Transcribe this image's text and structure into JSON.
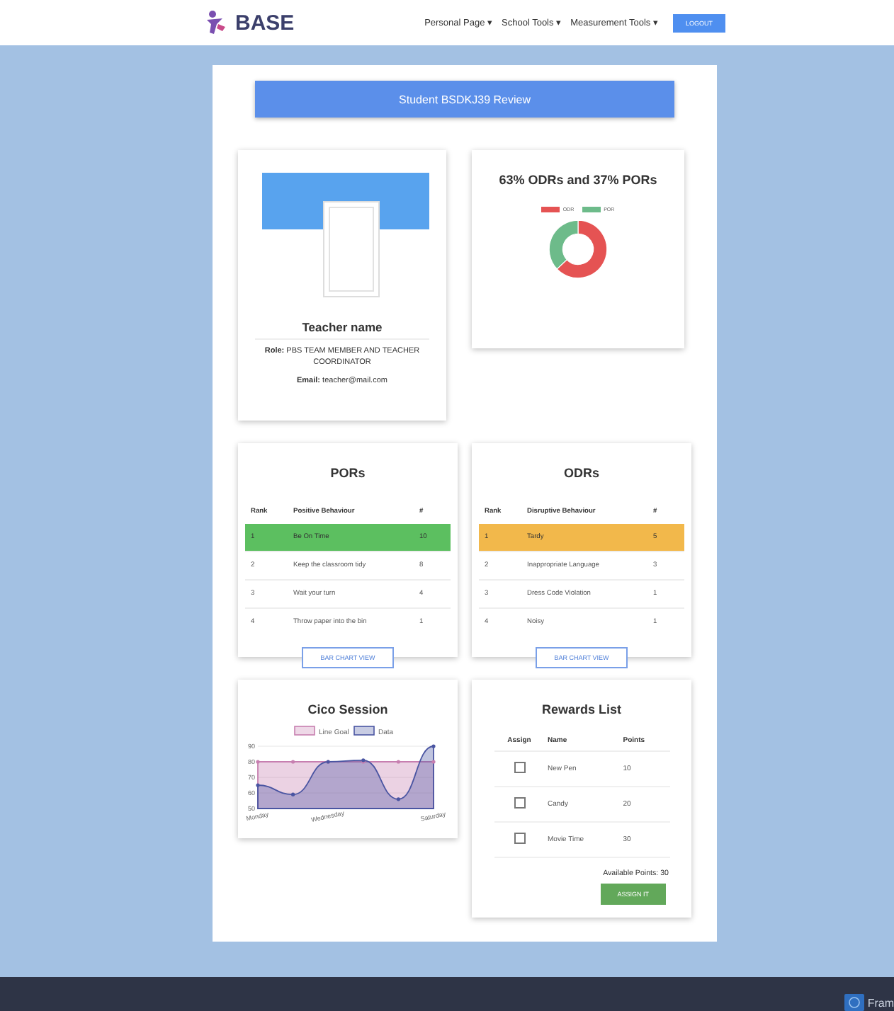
{
  "nav": {
    "logo": "BASE",
    "menus": [
      {
        "label": "Personal Page",
        "caret": "▾"
      },
      {
        "label": "School Tools",
        "caret": "▾"
      },
      {
        "label": "Measurement Tools",
        "caret": "▾"
      }
    ],
    "logout": "LOGOUT"
  },
  "header": {
    "title": "Student BSDKJ39 Review"
  },
  "teacher": {
    "name": "Teacher name",
    "role_label": "Role:",
    "role": "PBS TEAM MEMBER AND TEACHER COORDINATOR",
    "email_label": "Email:",
    "email": "teacher@mail.com"
  },
  "ratio": {
    "title": "63% ODRs and 37% PORs",
    "chart_data": {
      "type": "donut",
      "categories": [
        "ODR",
        "POR"
      ],
      "values": [
        63,
        37
      ],
      "colors": [
        "#e55353",
        "#6dbb8a"
      ],
      "legend": "top"
    }
  },
  "tables": [
    {
      "title": "PORs",
      "kind": "positive",
      "columns": [
        "Rank",
        "Positive Behaviour",
        "#"
      ],
      "rows": [
        {
          "cells": [
            "1",
            "Be On Time",
            "10"
          ],
          "highlighted": true
        },
        {
          "cells": [
            "2",
            "Keep the classroom tidy",
            "8"
          ],
          "highlighted": false
        },
        {
          "cells": [
            "3",
            "Wait your turn",
            "4"
          ],
          "highlighted": false
        },
        {
          "cells": [
            "4",
            "Throw paper into the bin",
            "1"
          ],
          "highlighted": false
        }
      ],
      "button": "BAR CHART VIEW"
    },
    {
      "title": "ODRs",
      "kind": "negative",
      "columns": [
        "Rank",
        "Disruptive Behaviour",
        "#"
      ],
      "rows": [
        {
          "cells": [
            "1",
            "Tardy",
            "5"
          ],
          "highlighted": true
        },
        {
          "cells": [
            "2",
            "Inappropriate Language",
            "3"
          ],
          "highlighted": false
        },
        {
          "cells": [
            "3",
            "Dress Code Violation",
            "1"
          ],
          "highlighted": false
        },
        {
          "cells": [
            "4",
            "Noisy",
            "1"
          ],
          "highlighted": false
        }
      ],
      "button": "BAR CHART VIEW"
    }
  ],
  "cico": {
    "title": "Cico Session",
    "chart_data": {
      "type": "area",
      "legend": "top",
      "categories": [
        "Monday",
        null,
        "Wednesday",
        null,
        null,
        "Saturday"
      ],
      "ylim": [
        50,
        90
      ],
      "yticks": [
        50,
        60,
        70,
        80,
        90
      ],
      "series": [
        {
          "name": "Line Goal",
          "color": "#c77fb0",
          "values": [
            80,
            80,
            80,
            80,
            80,
            80
          ]
        },
        {
          "name": "Data",
          "color": "#4a55a2",
          "values": [
            65,
            59,
            80,
            81,
            56,
            90
          ]
        }
      ]
    }
  },
  "rewards": {
    "title": "Rewards List",
    "columns": [
      "Assign",
      "Name",
      "Points"
    ],
    "rows": [
      {
        "name": "New Pen",
        "points": "10",
        "checked": false
      },
      {
        "name": "Candy",
        "points": "20",
        "checked": false
      },
      {
        "name": "Movie Time",
        "points": "30",
        "checked": false
      }
    ],
    "available": "Available Points: 30",
    "button": "ASSIGN IT"
  },
  "footer": {
    "text": "Fram"
  }
}
